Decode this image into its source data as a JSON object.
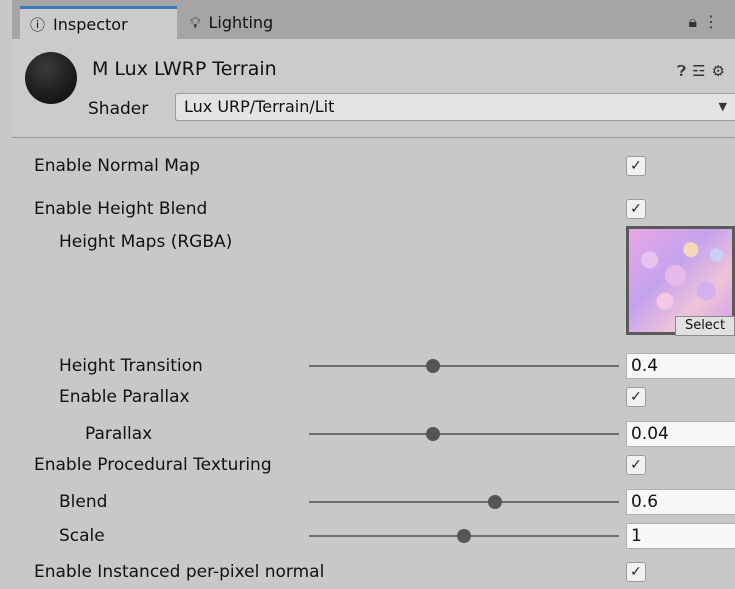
{
  "tabs": {
    "inspector": {
      "icon": "info-icon",
      "label": "Inspector"
    },
    "lighting": {
      "icon": "lightbulb-icon",
      "label": "Lighting"
    }
  },
  "header": {
    "material_name": "M Lux LWRP Terrain",
    "shader_label": "Shader",
    "shader_value": "Lux URP/Terrain/Lit"
  },
  "properties": {
    "enable_normal_map": {
      "label": "Enable Normal Map",
      "checked": true
    },
    "enable_height_blend": {
      "label": "Enable Height Blend",
      "checked": true
    },
    "height_maps": {
      "label": "Height Maps (RGBA)",
      "select_label": "Select"
    },
    "height_transition": {
      "label": "Height Transition",
      "value": "0.4",
      "slider_fraction": 0.4
    },
    "enable_parallax": {
      "label": "Enable Parallax",
      "checked": true
    },
    "parallax": {
      "label": "Parallax",
      "value": "0.04",
      "slider_fraction": 0.4
    },
    "enable_procedural_texturing": {
      "label": "Enable Procedural Texturing",
      "checked": true
    },
    "blend": {
      "label": "Blend",
      "value": "0.6",
      "slider_fraction": 0.6
    },
    "scale": {
      "label": "Scale",
      "value": "1",
      "slider_fraction": 0.5
    },
    "enable_instanced_normal": {
      "label": "Enable Instanced per-pixel normal",
      "checked": true
    }
  },
  "check_glyph": "✓"
}
